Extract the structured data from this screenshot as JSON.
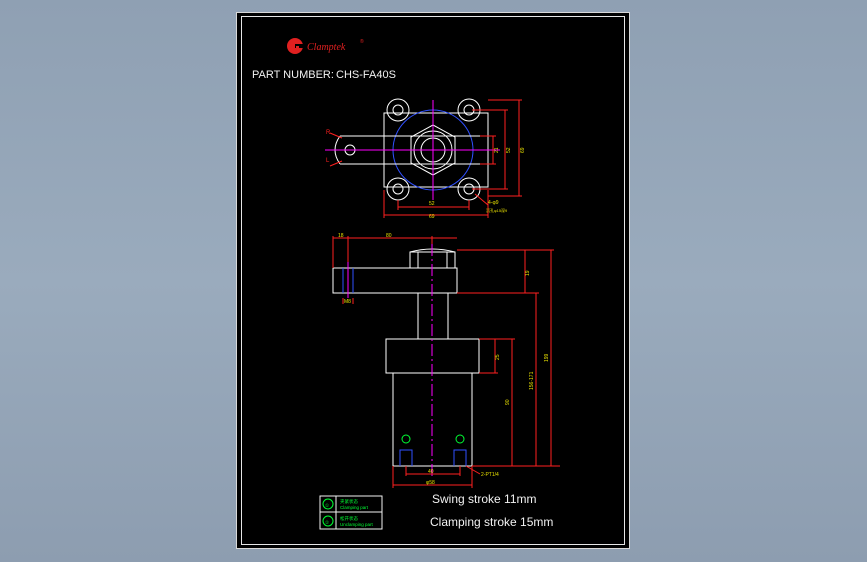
{
  "brand": {
    "name": "Clamptek",
    "reg": "®",
    "logo_color": "#e02020"
  },
  "part_number": {
    "label": "PART NUMBER:",
    "value": "CHS-FA40S"
  },
  "notes": {
    "swing": "Swing stroke 11mm",
    "clamping": "Clamping stroke 15mm"
  },
  "legend": [
    {
      "symbol": "①",
      "title": "夹紧状态",
      "caption": "Clamping part"
    },
    {
      "symbol": "②",
      "title": "松开状态",
      "caption": "Unclamping part"
    }
  ],
  "top_view": {
    "marks": {
      "r": "R",
      "l": "L"
    },
    "dims": {
      "pitch": "52",
      "width": "69",
      "h1": "21",
      "h2": "52",
      "h3": "69",
      "holes": "4-φ9",
      "counterbore": "沉孔φ15深9"
    }
  },
  "front_view": {
    "dims": {
      "arm_tip": "18",
      "arm_len": "80",
      "arm_hole": "M8",
      "top_h": "19",
      "body_top": "25",
      "body_h": "90",
      "stroke": "156-171",
      "total": "199"
    },
    "bottom": {
      "pitch": "40",
      "base": "φ58",
      "port": "2-PT1/4"
    }
  },
  "colors": {
    "outline": "#ffffff",
    "center": "#ff00ff",
    "hidden": "#3050ff",
    "dimension": "#ff2020",
    "text": "#e8e000",
    "note": "#00ff33"
  }
}
